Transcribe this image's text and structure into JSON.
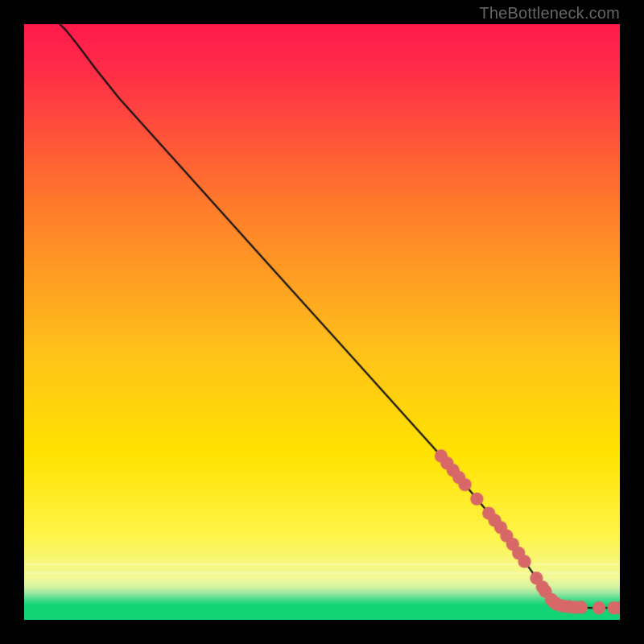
{
  "watermark": "TheBottleneck.com",
  "chart_data": {
    "type": "line",
    "title": "",
    "xlabel": "",
    "ylabel": "",
    "xlim": [
      0,
      100
    ],
    "ylim": [
      0,
      100
    ],
    "grid": false,
    "background_gradient_top": "#ff1a4b",
    "background_gradient_mid": "#ffdb00",
    "background_gradient_bottom_band": "#12d477",
    "curve": {
      "name": "bottleneck-curve",
      "points": [
        {
          "x": 6.0,
          "y": 100.0
        },
        {
          "x": 7.0,
          "y": 99.0
        },
        {
          "x": 9.0,
          "y": 96.5
        },
        {
          "x": 12.0,
          "y": 92.5
        },
        {
          "x": 16.0,
          "y": 87.5
        },
        {
          "x": 25.0,
          "y": 77.5
        },
        {
          "x": 40.0,
          "y": 60.8
        },
        {
          "x": 55.0,
          "y": 44.2
        },
        {
          "x": 70.0,
          "y": 27.5
        },
        {
          "x": 80.0,
          "y": 15.5
        },
        {
          "x": 86.0,
          "y": 7.0
        },
        {
          "x": 88.0,
          "y": 4.0
        },
        {
          "x": 90.0,
          "y": 2.5
        },
        {
          "x": 92.0,
          "y": 2.2
        },
        {
          "x": 95.0,
          "y": 2.0
        },
        {
          "x": 100.0,
          "y": 2.0
        }
      ]
    },
    "markers": {
      "color": "#d86868",
      "radius_frac": 0.011,
      "points": [
        {
          "x": 70.0,
          "y": 27.5
        },
        {
          "x": 71.0,
          "y": 26.3
        },
        {
          "x": 72.0,
          "y": 25.1
        },
        {
          "x": 73.0,
          "y": 23.9
        },
        {
          "x": 74.0,
          "y": 22.7
        },
        {
          "x": 76.0,
          "y": 20.3
        },
        {
          "x": 78.0,
          "y": 17.9
        },
        {
          "x": 79.0,
          "y": 16.7
        },
        {
          "x": 80.0,
          "y": 15.5
        },
        {
          "x": 81.0,
          "y": 14.1
        },
        {
          "x": 82.0,
          "y": 12.7
        },
        {
          "x": 83.0,
          "y": 11.2
        },
        {
          "x": 84.0,
          "y": 9.8
        },
        {
          "x": 86.0,
          "y": 7.0
        },
        {
          "x": 87.0,
          "y": 5.5
        },
        {
          "x": 87.5,
          "y": 4.8
        },
        {
          "x": 88.5,
          "y": 3.4
        },
        {
          "x": 89.0,
          "y": 2.9
        },
        {
          "x": 89.5,
          "y": 2.6
        },
        {
          "x": 90.5,
          "y": 2.3
        },
        {
          "x": 91.5,
          "y": 2.2
        },
        {
          "x": 92.5,
          "y": 2.1
        },
        {
          "x": 93.5,
          "y": 2.1
        },
        {
          "x": 96.5,
          "y": 2.0
        },
        {
          "x": 99.0,
          "y": 2.0
        },
        {
          "x": 100.0,
          "y": 2.0
        }
      ]
    }
  }
}
